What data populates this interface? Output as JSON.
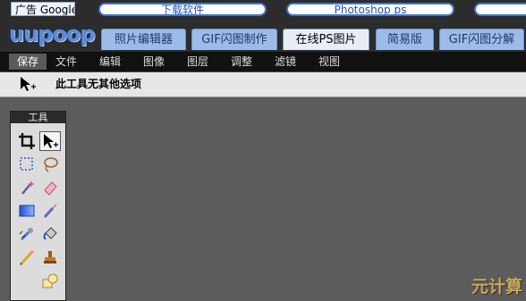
{
  "top": {
    "ad_label": "广告 Google",
    "links": [
      "下载软件",
      "Photoshop ps",
      ""
    ]
  },
  "logo": {
    "text": "uupoop"
  },
  "nav_tabs": [
    "照片编辑器",
    "GIF闪图制作",
    "在线PS图片",
    "简易版",
    "GIF闪图分解"
  ],
  "nav_active": "在线PS图片",
  "menu": [
    "保存",
    "文件",
    "编辑",
    "图像",
    "图层",
    "调整",
    "滤镜",
    "视图"
  ],
  "options": {
    "text": "此工具无其他选项"
  },
  "toolbox": {
    "title": "工具",
    "tools": [
      "crop-icon",
      "move-icon",
      "marquee-icon",
      "lasso-icon",
      "magic-wand-icon",
      "eraser-icon",
      "gradient-icon",
      "brush-icon",
      "clone-stamp-icon",
      "paint-bucket-icon",
      "pencil-icon",
      "stamp-icon",
      "shape-icon"
    ]
  },
  "watermark": "元计算",
  "colors": {
    "accent": "#3f74c9",
    "tab": "#9cbbe8",
    "canvas": "#5c5c5c"
  }
}
